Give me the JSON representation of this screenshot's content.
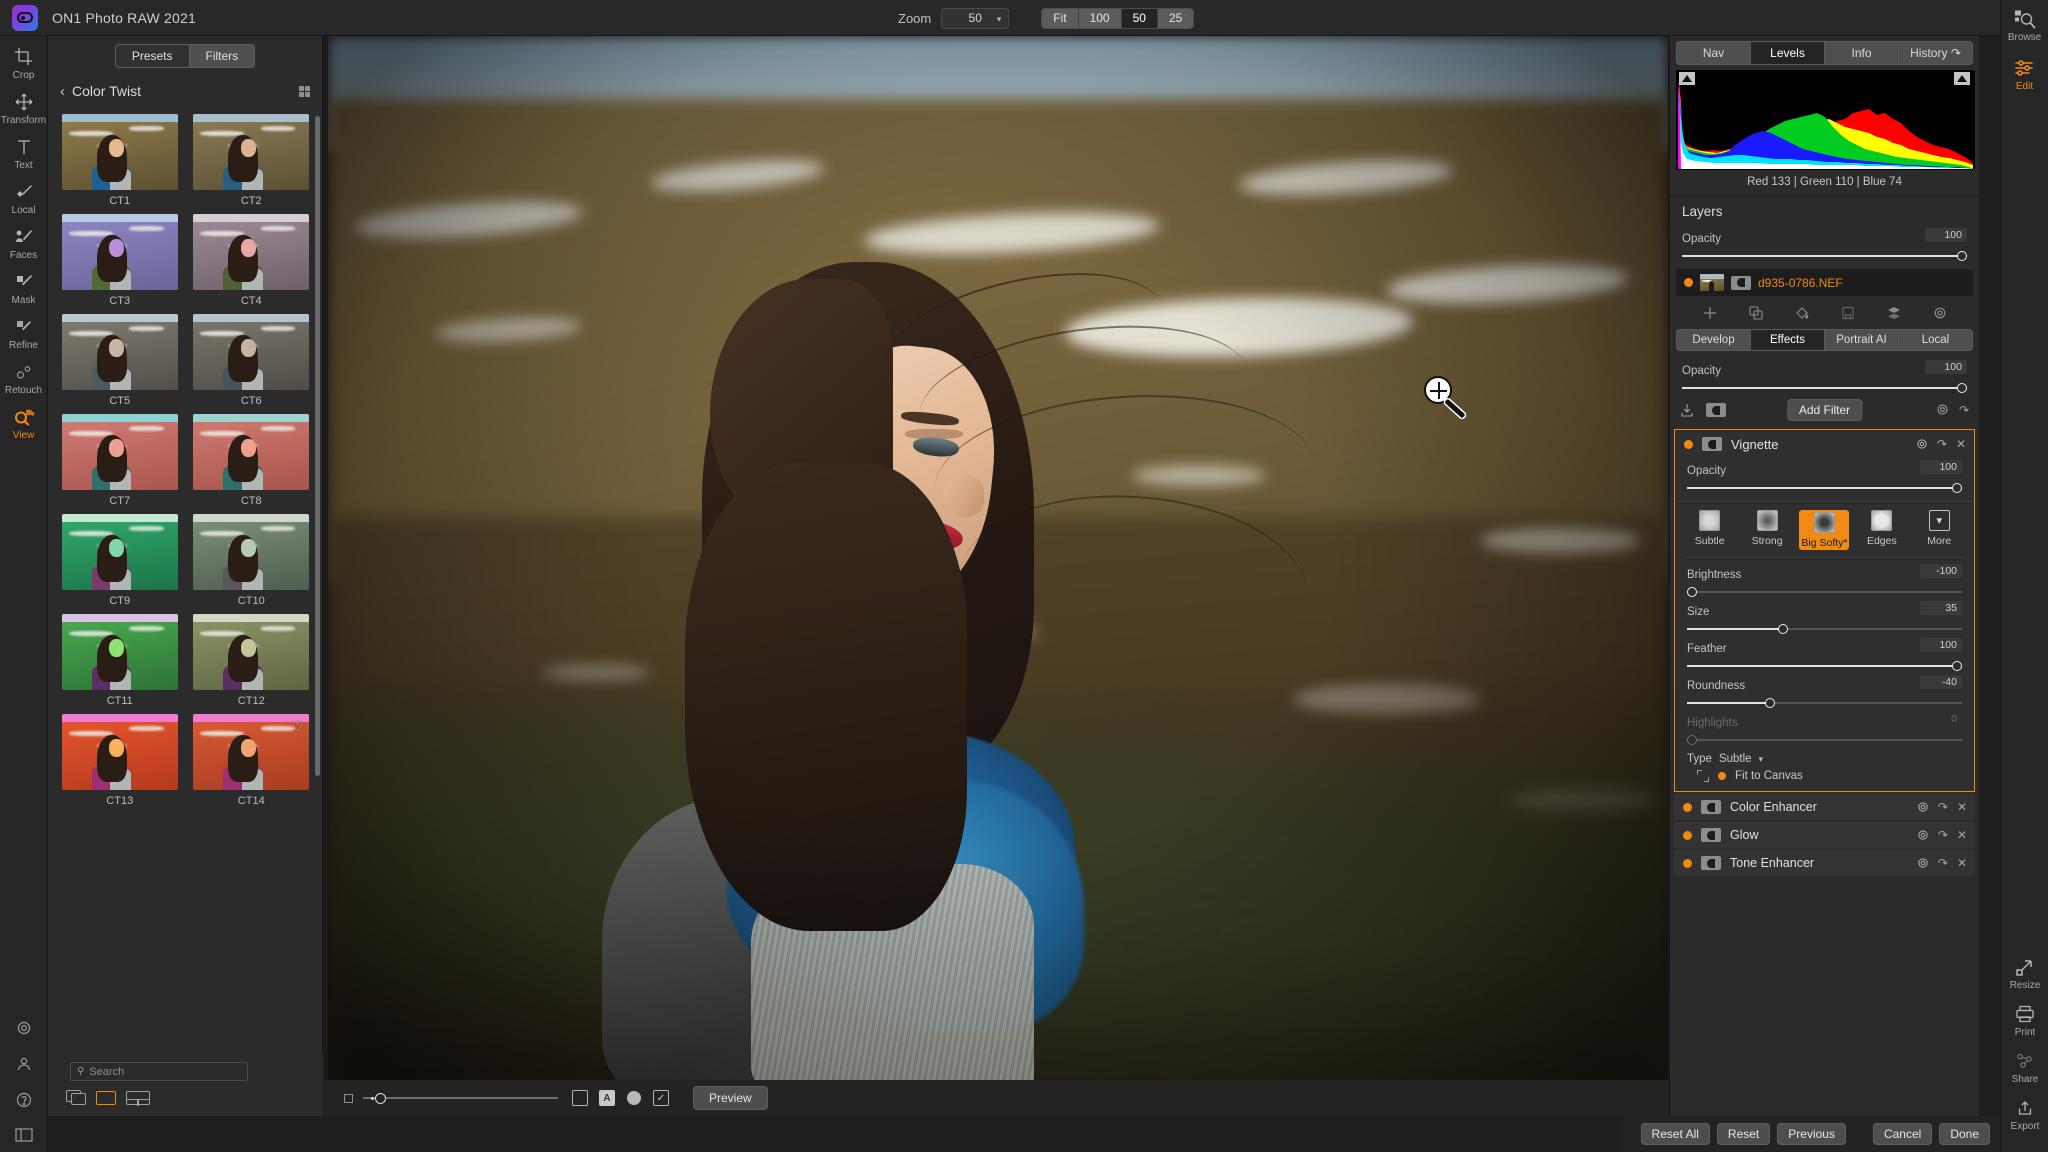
{
  "app": {
    "title": "ON1 Photo RAW 2021",
    "logo_icon": "on1-logo-icon"
  },
  "topbar": {
    "zoom_label": "Zoom",
    "zoom_value": "50",
    "zoom_steps": [
      {
        "label": "Fit",
        "active": false
      },
      {
        "label": "100",
        "active": false
      },
      {
        "label": "50",
        "active": true
      },
      {
        "label": "25",
        "active": false
      }
    ]
  },
  "left_rail": {
    "items": [
      {
        "label": "Crop",
        "icon": "crop-icon",
        "active": false
      },
      {
        "label": "Transform",
        "icon": "transform-icon",
        "active": false
      },
      {
        "label": "Text",
        "icon": "text-icon",
        "active": false
      },
      {
        "label": "Local",
        "icon": "local-adjust-icon",
        "active": false
      },
      {
        "label": "Faces",
        "icon": "faces-icon",
        "active": false
      },
      {
        "label": "Mask",
        "icon": "mask-brush-icon",
        "active": false
      },
      {
        "label": "Refine",
        "icon": "refine-brush-icon",
        "active": false
      },
      {
        "label": "Retouch",
        "icon": "retouch-icon",
        "active": false
      },
      {
        "label": "View",
        "icon": "view-hand-magnifier-icon",
        "active": true
      }
    ],
    "bottom_icons": [
      "gear-icon",
      "person-icon",
      "help-icon",
      "panel-toggle-icon"
    ]
  },
  "left_panel": {
    "tabs": [
      {
        "label": "Presets",
        "active": true
      },
      {
        "label": "Filters",
        "active": false
      }
    ],
    "back_icon": "chevron-left-icon",
    "category": "Color Twist",
    "grid_icon": "grid-view-icon",
    "presets": [
      {
        "label": "CT1",
        "sky": "#9dbdd0",
        "land1": "#8e7a4b",
        "land2": "#5d5030",
        "face": "#e8b88f",
        "body": "#1e5f94",
        "fav": false
      },
      {
        "label": "CT2",
        "sky": "#a9c0cc",
        "land1": "#8a7a54",
        "land2": "#5a5034",
        "face": "#ddb293",
        "body": "#275f84",
        "fav": false
      },
      {
        "label": "CT3",
        "sky": "#b9c9e8",
        "land1": "#8b86c4",
        "land2": "#6a6596",
        "face": "#b98fd8",
        "body": "#4f6b33",
        "fav": false
      },
      {
        "label": "CT4",
        "sky": "#d5cfd3",
        "land1": "#9b8a95",
        "land2": "#6d6068",
        "face": "#e6a7a7",
        "body": "#4e6136",
        "fav": false
      },
      {
        "label": "CT5",
        "sky": "#b7c8cf",
        "land1": "#7e7a70",
        "land2": "#514f48",
        "face": "#c9b5a6",
        "body": "#4a5a60",
        "fav": false
      },
      {
        "label": "CT6",
        "sky": "#b4c5cb",
        "land1": "#7a766c",
        "land2": "#4e4c45",
        "face": "#c5b2a4",
        "body": "#46555b",
        "fav": false
      },
      {
        "label": "CT7",
        "sky": "#8fd0d0",
        "land1": "#d07a72",
        "land2": "#a8564f",
        "face": "#f0a093",
        "body": "#2d6e6e",
        "fav": false
      },
      {
        "label": "CT8",
        "sky": "#9ed3d1",
        "land1": "#cf7a6f",
        "land2": "#a6544c",
        "face": "#efa08f",
        "body": "#2e6f6d",
        "fav": false
      },
      {
        "label": "CT9",
        "sky": "#c3e9d2",
        "land1": "#2fa86a",
        "land2": "#1d7249",
        "face": "#7fd6a6",
        "body": "#7a3a6d",
        "fav": false
      },
      {
        "label": "CT10",
        "sky": "#cfd8cd",
        "land1": "#7b8d7a",
        "land2": "#4f5e4f",
        "face": "#b8c9b6",
        "body": "#5c5560",
        "fav": false
      },
      {
        "label": "CT11",
        "sky": "#d9c2e4",
        "land1": "#47a84f",
        "land2": "#2e7236",
        "face": "#8ee273",
        "body": "#5c2c66",
        "fav": false
      },
      {
        "label": "CT12",
        "sky": "#d5d6c5",
        "land1": "#8a9464",
        "land2": "#5e6543",
        "face": "#c4c69a",
        "body": "#5a2e61",
        "fav": false
      },
      {
        "label": "CT13",
        "sky": "#f07ad0",
        "land1": "#e5542c",
        "land2": "#b43a1e",
        "face": "#f5b45c",
        "body": "#a32d72",
        "fav": false
      },
      {
        "label": "CT14",
        "sky": "#ef7ace",
        "land1": "#d75a33",
        "land2": "#a93c22",
        "face": "#f0a472",
        "body": "#9e2f70",
        "fav": true
      }
    ],
    "fav_icon": "heart-icon",
    "search_placeholder": "Search",
    "search_icon": "search-icon",
    "footer_icons": [
      "compare-screens-icon",
      "single-view-icon",
      "split-view-icon"
    ]
  },
  "canvas": {
    "cursor_icon": "magnifier-crosshair-cursor-icon",
    "footer": {
      "left_square_icon": "small-square-icon",
      "slider_value": 6,
      "icons": [
        {
          "name": "square-mask-icon",
          "glyph": ""
        },
        {
          "name": "letter-a-icon",
          "glyph": "A"
        },
        {
          "name": "circle-fill-icon",
          "glyph": ""
        },
        {
          "name": "checkbox-icon",
          "glyph": "✓"
        }
      ],
      "preview_label": "Preview"
    }
  },
  "right_panel": {
    "tabs": [
      {
        "label": "Nav",
        "active": false
      },
      {
        "label": "Levels",
        "active": true
      },
      {
        "label": "Info",
        "active": false
      },
      {
        "label": "History",
        "active": false,
        "icon": "undo-icon"
      }
    ],
    "histogram": {
      "readout": "Red 133 | Green 110 | Blue  74",
      "clip_left_icon": "clip-warning-left-icon",
      "clip_right_icon": "clip-warning-right-icon"
    },
    "layers_title": "Layers",
    "layers_opacity": {
      "label": "Opacity",
      "value": "100",
      "pct": 100
    },
    "layer": {
      "name": "d935-0786.NEF",
      "visibility_icon": "visibility-dot-icon",
      "thumb_icon": "layer-thumbnail",
      "mask_icon": "layer-mask-icon"
    },
    "layer_tools": [
      "add-layer-icon",
      "duplicate-layer-icon",
      "fill-layer-icon",
      "delete-layer-icon",
      "merge-layers-icon",
      "layer-settings-gear-icon"
    ],
    "mode_tabs": [
      {
        "label": "Develop",
        "active": false
      },
      {
        "label": "Effects",
        "active": true
      },
      {
        "label": "Portrait AI",
        "active": false
      },
      {
        "label": "Local",
        "active": false
      }
    ],
    "effects_opacity": {
      "label": "Opacity",
      "value": "100",
      "pct": 100
    },
    "filter_actions": {
      "left_icons": [
        "save-preset-icon",
        "mask-icon"
      ],
      "add_filter_label": "Add Filter",
      "right_icons": [
        "gear-icon",
        "reset-icon"
      ]
    },
    "vignette": {
      "name": "Vignette",
      "enabled_icon": "enabled-dot-icon",
      "mask_icon": "filter-mask-icon",
      "actions": [
        "gear-icon",
        "reset-icon",
        "close-icon"
      ],
      "opacity": {
        "label": "Opacity",
        "value": "100",
        "pct": 100
      },
      "styles": [
        {
          "label": "Subtle",
          "selected": false,
          "icon": "vignette-subtle-swatch"
        },
        {
          "label": "Strong",
          "selected": false,
          "icon": "vignette-strong-swatch"
        },
        {
          "label": "Big Softy*",
          "selected": true,
          "icon": "vignette-bigsofty-swatch"
        },
        {
          "label": "Edges",
          "selected": false,
          "icon": "vignette-edges-swatch"
        },
        {
          "label": "More",
          "selected": false,
          "icon": "chevron-down-icon"
        }
      ],
      "sliders": [
        {
          "label": "Brightness",
          "value": "-100",
          "pct": 0,
          "disabled": false
        },
        {
          "label": "Size",
          "value": "35",
          "pct": 35,
          "disabled": false
        },
        {
          "label": "Feather",
          "value": "100",
          "pct": 100,
          "disabled": false
        },
        {
          "label": "Roundness",
          "value": "-40",
          "pct": 30,
          "disabled": false
        },
        {
          "label": "Highlights",
          "value": "0",
          "pct": 0,
          "disabled": true
        }
      ],
      "type_label": "Type",
      "type_value": "Subtle",
      "type_caret_icon": "chevron-down-icon",
      "fit_icon": "fit-target-icon",
      "fit_dot_icon": "enabled-dot-icon",
      "fit_label": "Fit to Canvas"
    },
    "filters": [
      {
        "name": "Color Enhancer",
        "enabled_icon": "enabled-dot-icon",
        "mask_icon": "filter-mask-icon"
      },
      {
        "name": "Glow",
        "enabled_icon": "enabled-dot-icon",
        "mask_icon": "filter-mask-icon"
      },
      {
        "name": "Tone Enhancer",
        "enabled_icon": "enabled-dot-icon",
        "mask_icon": "filter-mask-icon"
      }
    ],
    "footer_buttons": [
      {
        "label": "Reset All"
      },
      {
        "label": "Reset"
      },
      {
        "label": "Previous"
      },
      {
        "label": "Cancel"
      },
      {
        "label": "Done"
      }
    ]
  },
  "right_rail": {
    "top_items": [
      {
        "label": "Browse",
        "icon": "browse-icon",
        "active": false
      },
      {
        "label": "Edit",
        "icon": "edit-sliders-icon",
        "active": true
      }
    ],
    "bottom_items": [
      {
        "label": "Resize",
        "icon": "resize-arrow-icon",
        "active": false
      },
      {
        "label": "Print",
        "icon": "printer-icon",
        "active": false
      },
      {
        "label": "Share",
        "icon": "share-nodes-icon",
        "active": false
      },
      {
        "label": "Export",
        "icon": "export-upload-icon",
        "active": false
      }
    ]
  }
}
